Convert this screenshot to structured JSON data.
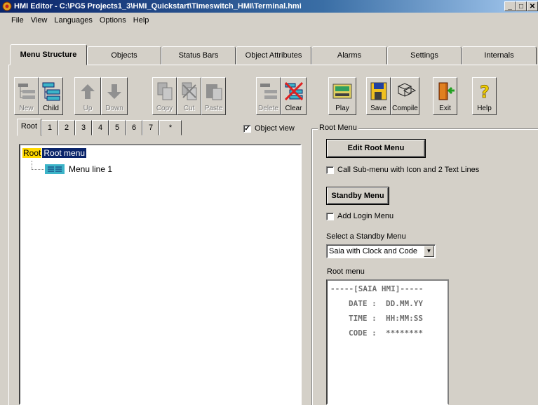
{
  "window": {
    "title": "HMI Editor - C:\\PG5 Projects1_3\\HMI_Quickstart\\Timeswitch_HMI\\Terminal.hmi"
  },
  "menubar": [
    "File",
    "View",
    "Languages",
    "Options",
    "Help"
  ],
  "tabs": [
    "Menu Structure",
    "Objects",
    "Status Bars",
    "Object Attributes",
    "Alarms",
    "Settings",
    "Internals"
  ],
  "toolbar": {
    "new": "New",
    "child": "Child",
    "up": "Up",
    "down": "Down",
    "copy": "Copy",
    "cut": "Cut",
    "paste": "Paste",
    "delete": "Delete",
    "clear": "Clear",
    "play": "Play",
    "save": "Save",
    "compile": "Compile",
    "exit": "Exit",
    "help": "Help"
  },
  "subtabs": [
    "Root",
    "1",
    "2",
    "3",
    "4",
    "5",
    "6",
    "7",
    "*"
  ],
  "object_view": {
    "label": "Object view",
    "checked": true
  },
  "tree": {
    "root_badge": "Root",
    "root_label": "Root menu",
    "child": "Menu line 1"
  },
  "root_menu": {
    "legend": "Root Menu",
    "edit_button": "Edit Root Menu",
    "call_submenu_label": "Call Sub-menu with Icon and 2 Text Lines",
    "standby_button": "Standby Menu",
    "add_login_label": "Add Login Menu",
    "select_label": "Select a Standby Menu",
    "select_value": "Saia with Clock and Code",
    "preview_label": "Root menu",
    "preview_lines": [
      "-----[SAIA HMI]-----",
      "DATE :  DD.MM.YY",
      "TIME :  HH:MM:SS",
      "CODE :  ********"
    ]
  }
}
